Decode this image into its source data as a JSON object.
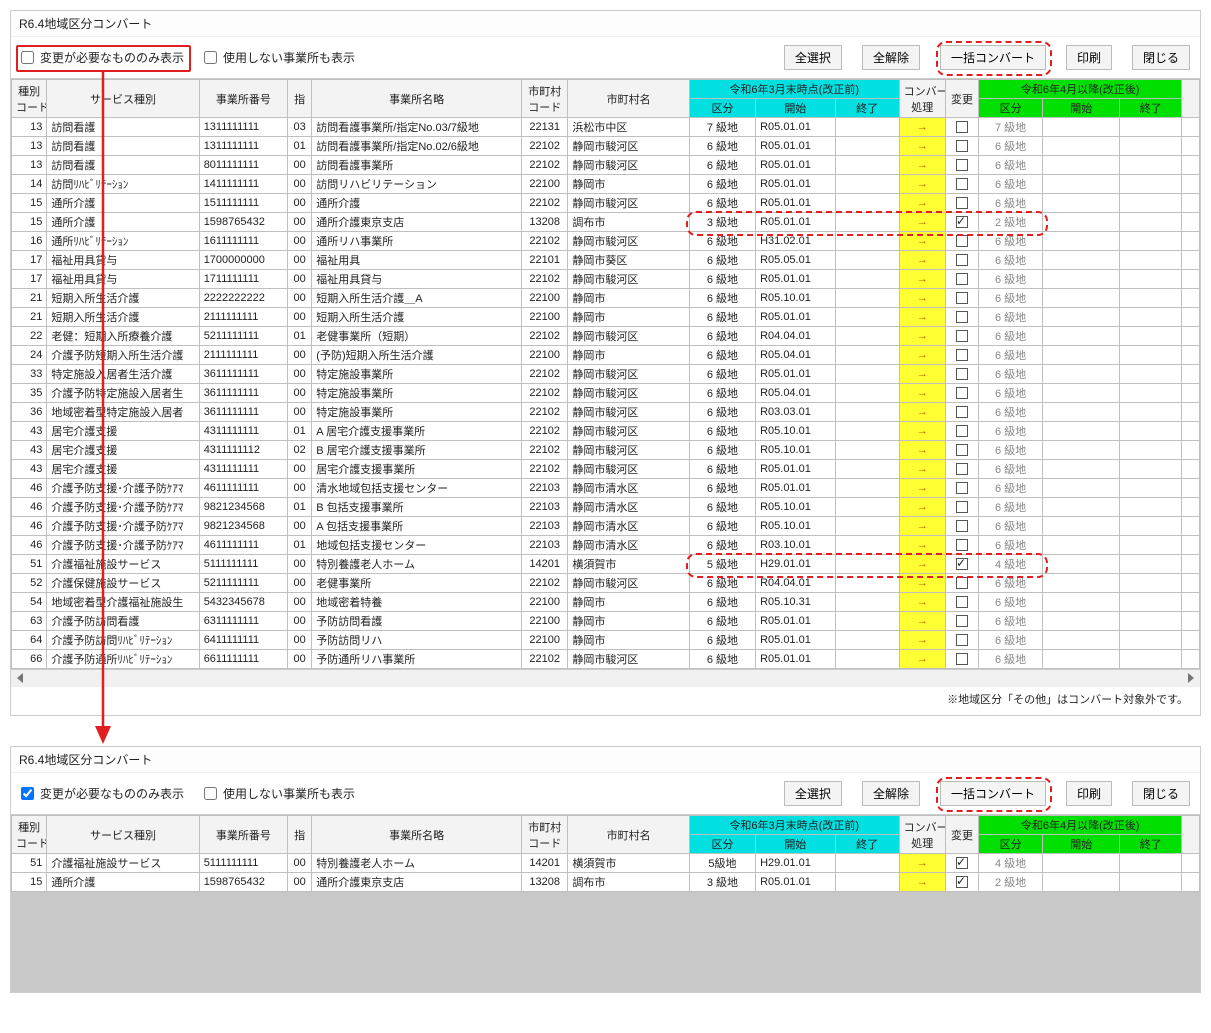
{
  "window_title": "R6.4地域区分コンバート",
  "toolbar": {
    "chk_changes_only": "変更が必要なもののみ表示",
    "chk_show_unused": "使用しない事業所も表示",
    "btn_select_all": "全選択",
    "btn_clear_all": "全解除",
    "btn_convert": "一括コンバート",
    "btn_print": "印刷",
    "btn_close": "閉じる"
  },
  "headers": {
    "code": "種別\nコード",
    "service": "サービス種別",
    "jigyosho_no": "事業所番号",
    "shi": "指",
    "jigyosho_name": "事業所名略",
    "city_code": "市町村\nコード",
    "city_name": "市町村名",
    "before_group": "令和6年3月末時点(改正前)",
    "kubun": "区分",
    "start": "開始",
    "end": "終了",
    "convert": "コンバート\n処理",
    "change": "変更",
    "after_group": "令和6年4月以降(改正後)"
  },
  "rows": [
    {
      "code": "13",
      "service": "訪問看護",
      "no": "1311111111",
      "shi": "03",
      "name": "訪問看護事業所/指定No.03/7級地",
      "ccode": "22131",
      "cname": "浜松市中区",
      "kubun": "7 級地",
      "start": "R05.01.01",
      "end": "",
      "chk": false,
      "akubun": "7 級地"
    },
    {
      "code": "13",
      "service": "訪問看護",
      "no": "1311111111",
      "shi": "01",
      "name": "訪問看護事業所/指定No.02/6級地",
      "ccode": "22102",
      "cname": "静岡市駿河区",
      "kubun": "6 級地",
      "start": "R05.01.01",
      "end": "",
      "chk": false,
      "akubun": "6 級地"
    },
    {
      "code": "13",
      "service": "訪問看護",
      "no": "8011111111",
      "shi": "00",
      "name": "訪問看護事業所",
      "ccode": "22102",
      "cname": "静岡市駿河区",
      "kubun": "6 級地",
      "start": "R05.01.01",
      "end": "",
      "chk": false,
      "akubun": "6 級地"
    },
    {
      "code": "14",
      "service": "訪問ﾘﾊﾋﾞﾘﾃｰｼｮﾝ",
      "no": "1411111111",
      "shi": "00",
      "name": "訪問リハビリテーション",
      "ccode": "22100",
      "cname": "静岡市",
      "kubun": "6 級地",
      "start": "R05.01.01",
      "end": "",
      "chk": false,
      "akubun": "6 級地"
    },
    {
      "code": "15",
      "service": "通所介護",
      "no": "1511111111",
      "shi": "00",
      "name": "通所介護",
      "ccode": "22102",
      "cname": "静岡市駿河区",
      "kubun": "6 級地",
      "start": "R05.01.01",
      "end": "",
      "chk": false,
      "akubun": "6 級地"
    },
    {
      "code": "15",
      "service": "通所介護",
      "no": "1598765432",
      "shi": "00",
      "name": "通所介護東京支店",
      "ccode": "13208",
      "cname": "調布市",
      "kubun": "3 級地",
      "start": "R05.01.01",
      "end": "",
      "chk": true,
      "akubun": "2 級地"
    },
    {
      "code": "16",
      "service": "通所ﾘﾊﾋﾞﾘﾃｰｼｮﾝ",
      "no": "1611111111",
      "shi": "00",
      "name": "通所リハ事業所",
      "ccode": "22102",
      "cname": "静岡市駿河区",
      "kubun": "6 級地",
      "start": "H31.02.01",
      "end": "",
      "chk": false,
      "akubun": "6 級地"
    },
    {
      "code": "17",
      "service": "福祉用具貸与",
      "no": "1700000000",
      "shi": "00",
      "name": "福祉用具",
      "ccode": "22101",
      "cname": "静岡市葵区",
      "kubun": "6 級地",
      "start": "R05.05.01",
      "end": "",
      "chk": false,
      "akubun": "6 級地"
    },
    {
      "code": "17",
      "service": "福祉用具貸与",
      "no": "1711111111",
      "shi": "00",
      "name": "福祉用具貸与",
      "ccode": "22102",
      "cname": "静岡市駿河区",
      "kubun": "6 級地",
      "start": "R05.01.01",
      "end": "",
      "chk": false,
      "akubun": "6 級地"
    },
    {
      "code": "21",
      "service": "短期入所生活介護",
      "no": "2222222222",
      "shi": "00",
      "name": "短期入所生活介護＿A",
      "ccode": "22100",
      "cname": "静岡市",
      "kubun": "6 級地",
      "start": "R05.10.01",
      "end": "",
      "chk": false,
      "akubun": "6 級地"
    },
    {
      "code": "21",
      "service": "短期入所生活介護",
      "no": "2111111111",
      "shi": "00",
      "name": "短期入所生活介護",
      "ccode": "22100",
      "cname": "静岡市",
      "kubun": "6 級地",
      "start": "R05.01.01",
      "end": "",
      "chk": false,
      "akubun": "6 級地"
    },
    {
      "code": "22",
      "service": "老健：短期入所療養介護",
      "no": "5211111111",
      "shi": "01",
      "name": "老健事業所（短期）",
      "ccode": "22102",
      "cname": "静岡市駿河区",
      "kubun": "6 級地",
      "start": "R04.04.01",
      "end": "",
      "chk": false,
      "akubun": "6 級地"
    },
    {
      "code": "24",
      "service": "介護予防短期入所生活介護",
      "no": "2111111111",
      "shi": "00",
      "name": "(予防)短期入所生活介護",
      "ccode": "22100",
      "cname": "静岡市",
      "kubun": "6 級地",
      "start": "R05.04.01",
      "end": "",
      "chk": false,
      "akubun": "6 級地"
    },
    {
      "code": "33",
      "service": "特定施設入居者生活介護",
      "no": "3611111111",
      "shi": "00",
      "name": "特定施設事業所",
      "ccode": "22102",
      "cname": "静岡市駿河区",
      "kubun": "6 級地",
      "start": "R05.01.01",
      "end": "",
      "chk": false,
      "akubun": "6 級地"
    },
    {
      "code": "35",
      "service": "介護予防特定施設入居者生",
      "no": "3611111111",
      "shi": "00",
      "name": "特定施設事業所",
      "ccode": "22102",
      "cname": "静岡市駿河区",
      "kubun": "6 級地",
      "start": "R05.04.01",
      "end": "",
      "chk": false,
      "akubun": "6 級地"
    },
    {
      "code": "36",
      "service": "地域密着型特定施設入居者",
      "no": "3611111111",
      "shi": "00",
      "name": "特定施設事業所",
      "ccode": "22102",
      "cname": "静岡市駿河区",
      "kubun": "6 級地",
      "start": "R03.03.01",
      "end": "",
      "chk": false,
      "akubun": "6 級地"
    },
    {
      "code": "43",
      "service": "居宅介護支援",
      "no": "4311111111",
      "shi": "01",
      "name": "A 居宅介護支援事業所",
      "ccode": "22102",
      "cname": "静岡市駿河区",
      "kubun": "6 級地",
      "start": "R05.10.01",
      "end": "",
      "chk": false,
      "akubun": "6 級地"
    },
    {
      "code": "43",
      "service": "居宅介護支援",
      "no": "4311111112",
      "shi": "02",
      "name": "B 居宅介護支援事業所",
      "ccode": "22102",
      "cname": "静岡市駿河区",
      "kubun": "6 級地",
      "start": "R05.10.01",
      "end": "",
      "chk": false,
      "akubun": "6 級地"
    },
    {
      "code": "43",
      "service": "居宅介護支援",
      "no": "4311111111",
      "shi": "00",
      "name": "居宅介護支援事業所",
      "ccode": "22102",
      "cname": "静岡市駿河区",
      "kubun": "6 級地",
      "start": "R05.01.01",
      "end": "",
      "chk": false,
      "akubun": "6 級地"
    },
    {
      "code": "46",
      "service": "介護予防支援･介護予防ｹｱﾏ",
      "no": "4611111111",
      "shi": "00",
      "name": "清水地域包括支援センター",
      "ccode": "22103",
      "cname": "静岡市清水区",
      "kubun": "6 級地",
      "start": "R05.01.01",
      "end": "",
      "chk": false,
      "akubun": "6 級地"
    },
    {
      "code": "46",
      "service": "介護予防支援･介護予防ｹｱﾏ",
      "no": "9821234568",
      "shi": "01",
      "name": "B 包括支援事業所",
      "ccode": "22103",
      "cname": "静岡市清水区",
      "kubun": "6 級地",
      "start": "R05.10.01",
      "end": "",
      "chk": false,
      "akubun": "6 級地"
    },
    {
      "code": "46",
      "service": "介護予防支援･介護予防ｹｱﾏ",
      "no": "9821234568",
      "shi": "00",
      "name": "A 包括支援事業所",
      "ccode": "22103",
      "cname": "静岡市清水区",
      "kubun": "6 級地",
      "start": "R05.10.01",
      "end": "",
      "chk": false,
      "akubun": "6 級地"
    },
    {
      "code": "46",
      "service": "介護予防支援･介護予防ｹｱﾏ",
      "no": "4611111111",
      "shi": "01",
      "name": "地域包括支援センター",
      "ccode": "22103",
      "cname": "静岡市清水区",
      "kubun": "6 級地",
      "start": "R03.10.01",
      "end": "",
      "chk": false,
      "akubun": "6 級地"
    },
    {
      "code": "51",
      "service": "介護福祉施設サービス",
      "no": "5111111111",
      "shi": "00",
      "name": "特別養護老人ホーム",
      "ccode": "14201",
      "cname": "横須賀市",
      "kubun": "5 級地",
      "start": "H29.01.01",
      "end": "",
      "chk": true,
      "akubun": "4 級地"
    },
    {
      "code": "52",
      "service": "介護保健施設サービス",
      "no": "5211111111",
      "shi": "00",
      "name": "老健事業所",
      "ccode": "22102",
      "cname": "静岡市駿河区",
      "kubun": "6 級地",
      "start": "R04.04.01",
      "end": "",
      "chk": false,
      "akubun": "6 級地"
    },
    {
      "code": "54",
      "service": "地域密着型介護福祉施設生",
      "no": "5432345678",
      "shi": "00",
      "name": "地域密着特養",
      "ccode": "22100",
      "cname": "静岡市",
      "kubun": "6 級地",
      "start": "R05.10.31",
      "end": "",
      "chk": false,
      "akubun": "6 級地"
    },
    {
      "code": "63",
      "service": "介護予防訪問看護",
      "no": "6311111111",
      "shi": "00",
      "name": "予防訪問看護",
      "ccode": "22100",
      "cname": "静岡市",
      "kubun": "6 級地",
      "start": "R05.01.01",
      "end": "",
      "chk": false,
      "akubun": "6 級地"
    },
    {
      "code": "64",
      "service": "介護予防訪問ﾘﾊﾋﾞﾘﾃｰｼｮﾝ",
      "no": "6411111111",
      "shi": "00",
      "name": "予防訪問リハ",
      "ccode": "22100",
      "cname": "静岡市",
      "kubun": "6 級地",
      "start": "R05.01.01",
      "end": "",
      "chk": false,
      "akubun": "6 級地"
    },
    {
      "code": "66",
      "service": "介護予防通所ﾘﾊﾋﾞﾘﾃｰｼｮﾝ",
      "no": "6611111111",
      "shi": "00",
      "name": "予防通所リハ事業所",
      "ccode": "22102",
      "cname": "静岡市駿河区",
      "kubun": "6 級地",
      "start": "R05.01.01",
      "end": "",
      "chk": false,
      "akubun": "6 級地"
    }
  ],
  "rows2": [
    {
      "code": "51",
      "service": "介護福祉施設サービス",
      "no": "5111111111",
      "shi": "00",
      "name": "特別養護老人ホーム",
      "ccode": "14201",
      "cname": "横須賀市",
      "kubun": "5級地",
      "start": "H29.01.01",
      "end": "",
      "chk": true,
      "akubun": "4 級地"
    },
    {
      "code": "15",
      "service": "通所介護",
      "no": "1598765432",
      "shi": "00",
      "name": "通所介護東京支店",
      "ccode": "13208",
      "cname": "調布市",
      "kubun": "3 級地",
      "start": "R05.01.01",
      "end": "",
      "chk": true,
      "akubun": "2 級地"
    }
  ],
  "footer_note": "※地域区分「その他」はコンバート対象外です。",
  "arrow_sym": "→"
}
